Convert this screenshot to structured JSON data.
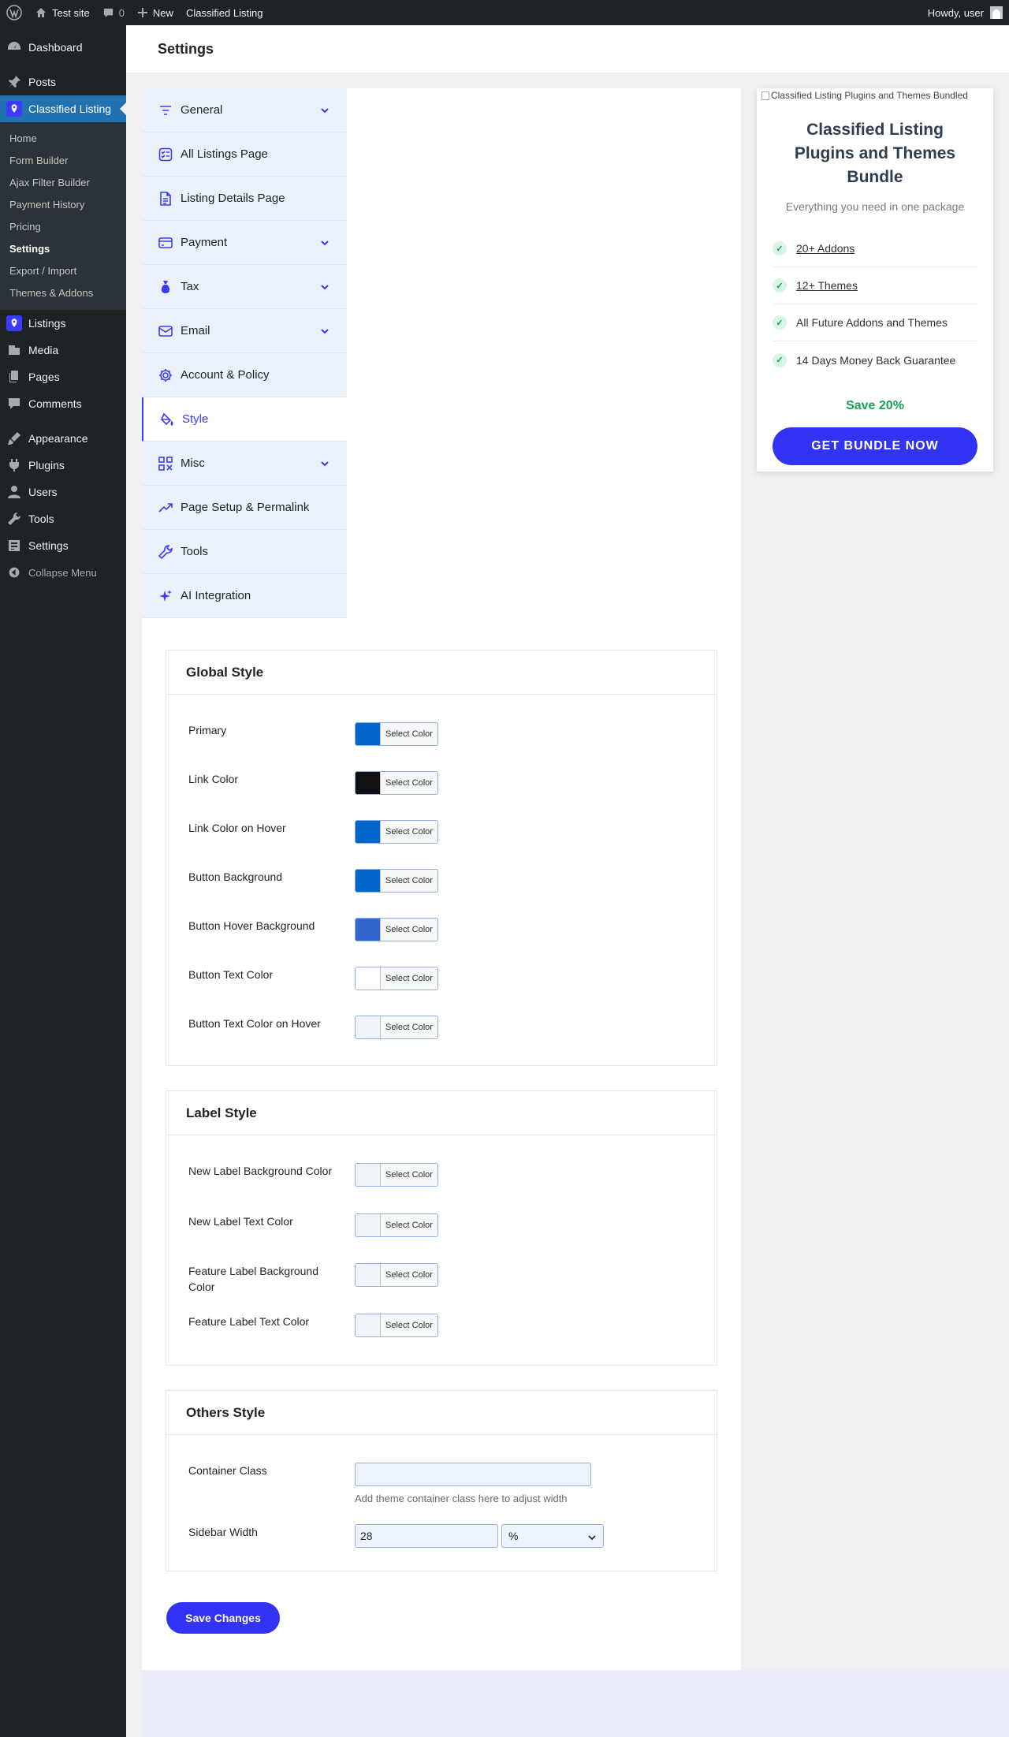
{
  "adminbar": {
    "site_name": "Test site",
    "comments_count": "0",
    "new_label": "New",
    "plugin_label": "Classified Listing",
    "howdy": "Howdy, user"
  },
  "sidebar": {
    "dashboard": "Dashboard",
    "posts": "Posts",
    "classified_listing": "Classified Listing",
    "submenu": [
      "Home",
      "Form Builder",
      "Ajax Filter Builder",
      "Payment History",
      "Pricing",
      "Settings",
      "Export / Import",
      "Themes & Addons"
    ],
    "listings": "Listings",
    "media": "Media",
    "pages": "Pages",
    "comments": "Comments",
    "appearance": "Appearance",
    "plugins": "Plugins",
    "users": "Users",
    "tools": "Tools",
    "settings": "Settings",
    "collapse": "Collapse Menu"
  },
  "header": {
    "title": "Settings"
  },
  "tabs": [
    {
      "label": "General",
      "icon": "filter-lines-icon",
      "has_submenu": true
    },
    {
      "label": "All Listings Page",
      "icon": "list-check-icon",
      "has_submenu": false
    },
    {
      "label": "Listing Details Page",
      "icon": "document-icon",
      "has_submenu": false
    },
    {
      "label": "Payment",
      "icon": "card-icon",
      "has_submenu": true
    },
    {
      "label": "Tax",
      "icon": "money-bag-icon",
      "has_submenu": true
    },
    {
      "label": "Email",
      "icon": "envelope-icon",
      "has_submenu": true
    },
    {
      "label": "Account & Policy",
      "icon": "gear-icon",
      "has_submenu": false
    },
    {
      "label": "Style",
      "icon": "paint-bucket-icon",
      "has_submenu": false,
      "active": true
    },
    {
      "label": "Misc",
      "icon": "grid-icon",
      "has_submenu": true
    },
    {
      "label": "Page Setup & Permalink",
      "icon": "trend-up-icon",
      "has_submenu": false
    },
    {
      "label": "Tools",
      "icon": "wrench-icon",
      "has_submenu": false
    },
    {
      "label": "AI Integration",
      "icon": "sparkle-icon",
      "has_submenu": false
    }
  ],
  "global_style": {
    "title": "Global Style",
    "select_color_label": "Select Color",
    "fields": [
      {
        "label": "Primary",
        "color": "#0066cc"
      },
      {
        "label": "Link Color",
        "color": "#111111"
      },
      {
        "label": "Link Color on Hover",
        "color": "#0066cc"
      },
      {
        "label": "Button Background",
        "color": "#0066cc"
      },
      {
        "label": "Button Hover Background",
        "color": "#3366cc"
      },
      {
        "label": "Button Text Color",
        "color": "#ffffff"
      },
      {
        "label": "Button Text Color on Hover",
        "color": "#f0f4f8"
      }
    ]
  },
  "label_style": {
    "title": "Label Style",
    "fields": [
      {
        "label": "New Label Background Color",
        "color": "#f0f4f8"
      },
      {
        "label": "New Label Text Color",
        "color": "#f0f4f8"
      },
      {
        "label": "Feature Label Background Color",
        "color": "#f0f4f8"
      },
      {
        "label": "Feature Label Text Color",
        "color": "#f0f4f8"
      }
    ]
  },
  "others_style": {
    "title": "Others Style",
    "container_class_label": "Container Class",
    "container_class_value": "",
    "container_class_hint": "Add theme container class here to adjust width",
    "sidebar_width_label": "Sidebar Width",
    "sidebar_width_value": "28",
    "sidebar_width_unit": "%"
  },
  "save_button": "Save Changes",
  "promo": {
    "image_alt": "Classified Listing Plugins and Themes Bundled",
    "title": "Classified Listing Plugins and Themes Bundle",
    "tagline": "Everything you need in one package",
    "features": [
      {
        "text": "20+ Addons",
        "link": true
      },
      {
        "text": "12+ Themes",
        "link": true
      },
      {
        "text": "All Future Addons and Themes",
        "link": false
      },
      {
        "text": "14 Days Money Back Guarantee",
        "link": false
      }
    ],
    "check_glyph": "✓",
    "save_text": "Save 20%",
    "button": "GET BUNDLE NOW"
  },
  "colors": {
    "accent": "#3333f5",
    "wp_blue": "#2271b1",
    "success": "#1aa053"
  }
}
